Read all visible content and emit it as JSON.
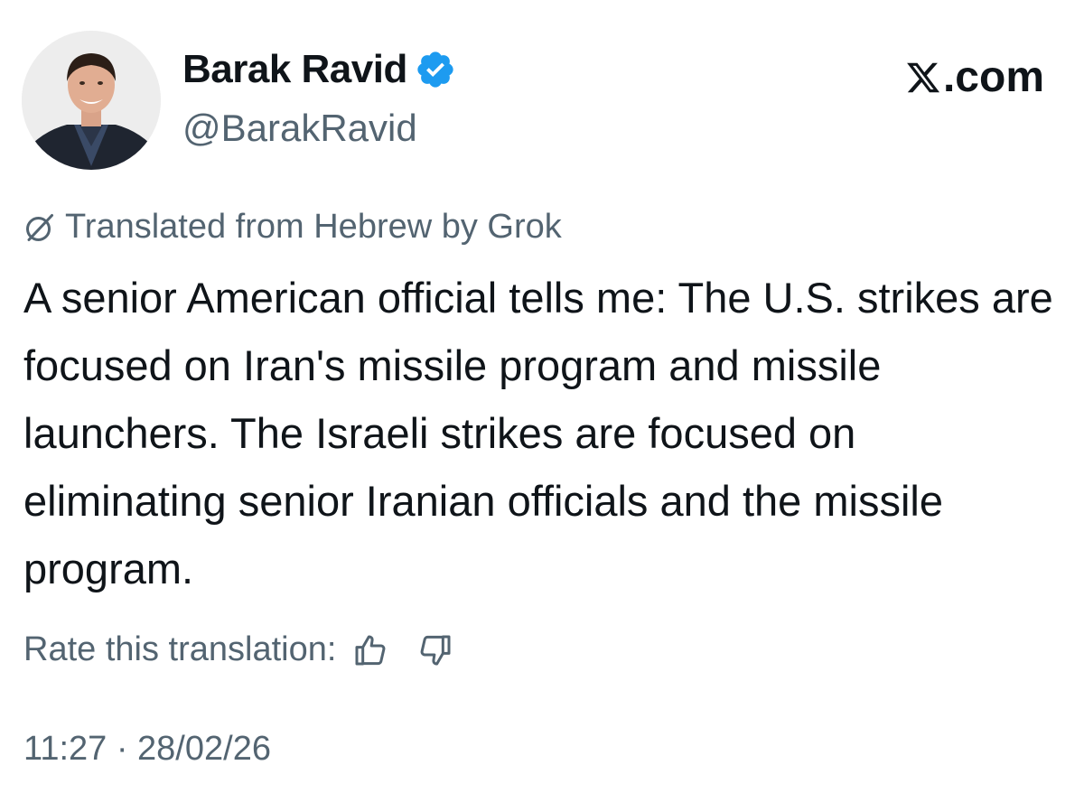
{
  "author": {
    "display_name": "Barak Ravid",
    "handle": "@BarakRavid",
    "verified": true
  },
  "brand": {
    "label": ".com",
    "logo_icon": "x-logo-icon"
  },
  "translation_notice": "Translated from Hebrew by Grok",
  "tweet": {
    "text": "A senior American official tells me: The U.S. strikes are focused on Iran's missile program and missile launchers. The Israeli strikes are focused on eliminating senior Iranian officials and the missile program."
  },
  "rating": {
    "label": "Rate this translation:",
    "up_icon": "thumbs-up-icon",
    "down_icon": "thumbs-down-icon"
  },
  "timestamp": "11:27 · 28/02/26",
  "colors": {
    "text_primary": "#0f1419",
    "text_secondary": "#536471",
    "verified_blue": "#1d9bf0"
  }
}
